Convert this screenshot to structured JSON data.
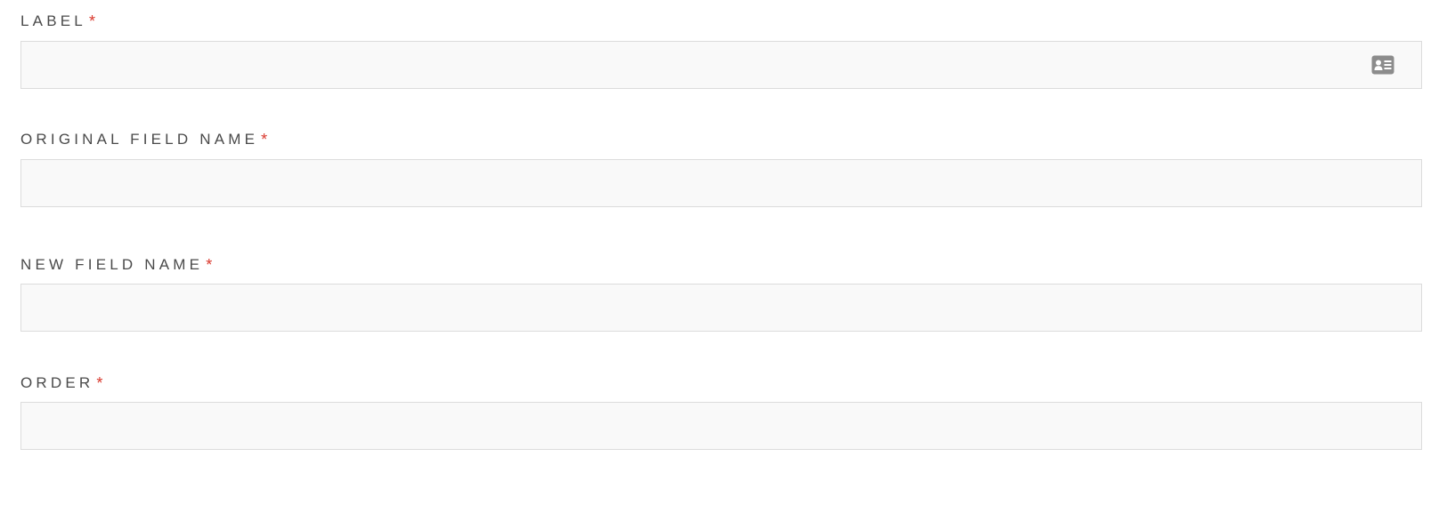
{
  "form": {
    "required_marker": "*",
    "fields": [
      {
        "label": "LABEL",
        "value": "",
        "placeholder": "",
        "icon": "contact-card-icon"
      },
      {
        "label": "ORIGINAL FIELD NAME",
        "value": "",
        "placeholder": ""
      },
      {
        "label": "NEW FIELD NAME",
        "value": "",
        "placeholder": ""
      },
      {
        "label": "ORDER",
        "value": "",
        "placeholder": ""
      }
    ]
  },
  "colors": {
    "label_text": "#4a4a4a",
    "required_star": "#d9382c",
    "input_background": "#f9f9f9",
    "input_border": "#dcdcdc",
    "icon": "#8c8c8c"
  }
}
